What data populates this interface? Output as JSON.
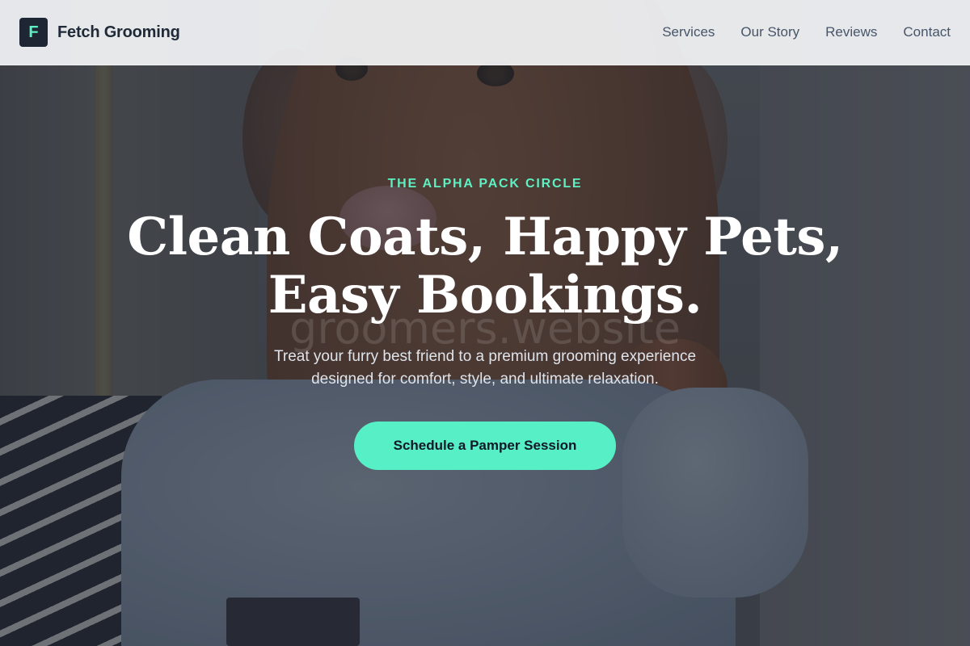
{
  "header": {
    "logo_letter": "F",
    "brand_name": "Fetch Grooming",
    "nav": [
      {
        "label": "Services"
      },
      {
        "label": "Our Story"
      },
      {
        "label": "Reviews"
      },
      {
        "label": "Contact"
      }
    ]
  },
  "hero": {
    "eyebrow": "THE ALPHA PACK CIRCLE",
    "headline_line1": "Clean Coats, Happy Pets,",
    "headline_line2": "Easy Bookings.",
    "watermark": "groomers.website",
    "subtext": "Treat your furry best friend to a premium grooming experience designed for comfort, style, and ultimate relaxation.",
    "cta_label": "Schedule a Pamper Session"
  },
  "colors": {
    "accent": "#56efc6",
    "logo_bg": "#1e2533",
    "header_bg": "#f3f4f6",
    "overlay": "#222834"
  }
}
